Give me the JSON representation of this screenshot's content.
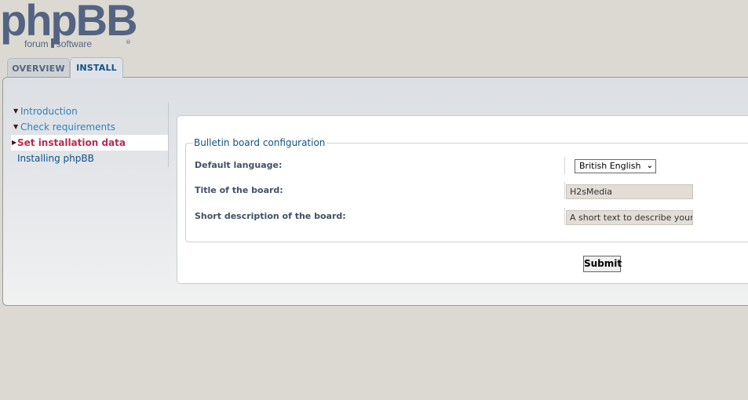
{
  "logo": {
    "main": "phpBB",
    "sub_left": "forum",
    "sub_right": "software",
    "reg": "®"
  },
  "tabs": [
    {
      "label": "OVERVIEW",
      "active": false
    },
    {
      "label": "INSTALL",
      "active": true
    }
  ],
  "menu": {
    "items": [
      {
        "label": "Introduction",
        "state": "done",
        "arrow": "v"
      },
      {
        "label": "Check requirements",
        "state": "done",
        "arrow": "v"
      },
      {
        "label": "Set installation data",
        "state": "active",
        "arrow": ">"
      },
      {
        "label": "Installing phpBB",
        "state": "pending",
        "arrow": ""
      }
    ]
  },
  "form": {
    "legend": "Bulletin board configuration",
    "fields": [
      {
        "label": "Default language:",
        "type": "select",
        "value": "British English"
      },
      {
        "label": "Title of the board:",
        "type": "text",
        "value": "H2sMedia"
      },
      {
        "label": "Short description of the board:",
        "type": "text",
        "value": "A short text to describe your forum"
      }
    ],
    "submit_label": "Submit"
  },
  "icons": {
    "done_arrow": "⌄",
    "active_arrow": "›",
    "select_chevron": "⌄"
  },
  "colors": {
    "link": "#2f81c2",
    "active": "#bc2a4d",
    "heading": "#105289",
    "brand": "#536482"
  }
}
